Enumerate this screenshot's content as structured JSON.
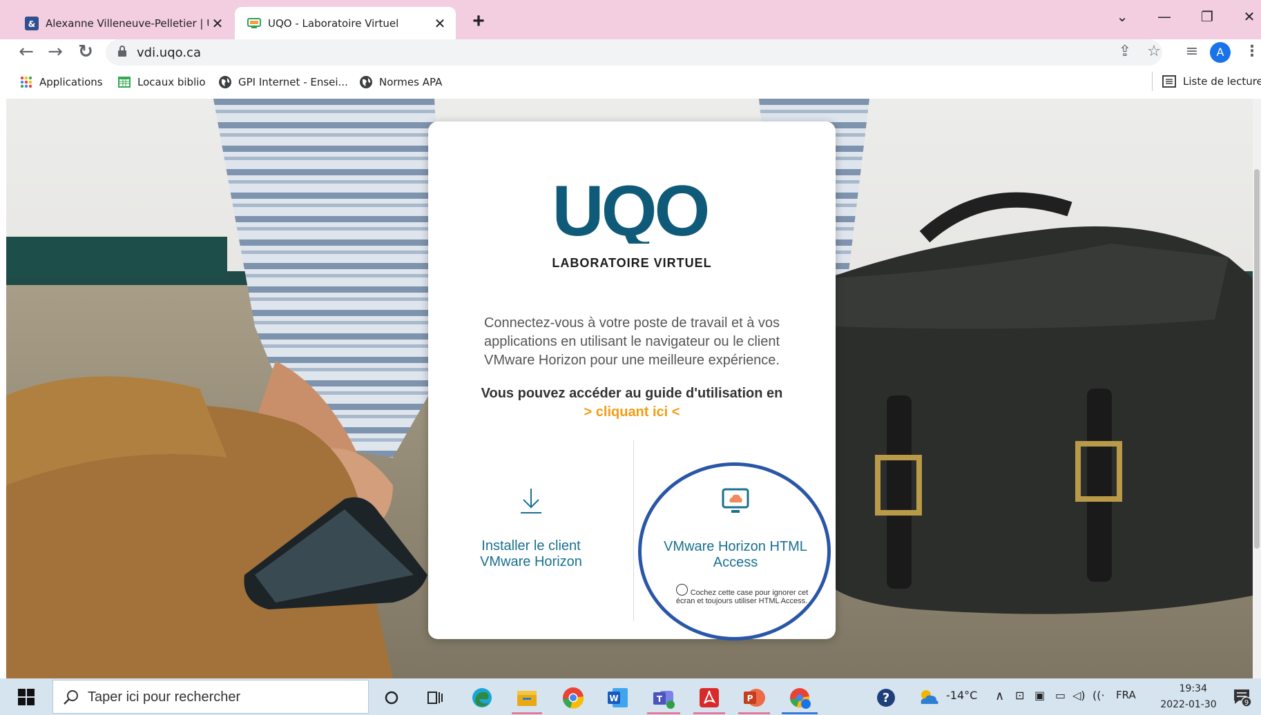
{
  "browser": {
    "tabs": [
      {
        "title": "Alexanne Villeneuve-Pelletier | UQ"
      },
      {
        "title": "UQO - Laboratoire Virtuel"
      }
    ],
    "new_tab": "+",
    "url": "vdi.uqo.ca",
    "profile_initial": "A",
    "bookmarks": [
      {
        "label": "Applications"
      },
      {
        "label": "Locaux biblio"
      },
      {
        "label": "GPI Internet - Ensei..."
      },
      {
        "label": "Normes APA"
      }
    ],
    "reading_list": "Liste de lecture"
  },
  "page": {
    "logo_text": "UQO",
    "subtitle": "LABORATOIRE VIRTUEL",
    "intro": "Connectez-vous à votre poste de travail et à vos applications en utilisant le navigateur ou le client VMware Horizon pour une meilleure expérience.",
    "guide_text": "Vous pouvez accéder au guide d'utilisation en",
    "guide_link": "> cliquant ici <",
    "install_option": "Installer le client VMware Horizon",
    "html_option": "VMware Horizon HTML Access",
    "skip_checkbox_label": "Cochez cette case pour ignorer cet écran et toujours utiliser HTML Access."
  },
  "taskbar": {
    "search_placeholder": "Taper ici pour rechercher",
    "weather": "-14°C",
    "language": "FRA",
    "time": "19:34",
    "date": "2022-01-30",
    "notifications": "9"
  },
  "colors": {
    "tab_strip": "#f3cde0",
    "uqo_teal": "#0f5a78",
    "link_teal": "#17708f",
    "guide_link": "#f39c12",
    "highlight_circle": "#2a56a8",
    "taskbar": "#d6e4ef"
  },
  "icons": [
    "start-icon",
    "search-icon",
    "cortana-icon",
    "task-view-icon",
    "edge-icon",
    "file-explorer-icon",
    "chrome-icon",
    "word-icon",
    "teams-icon",
    "acrobat-icon",
    "powerpoint-icon",
    "chrome-profile-icon",
    "help-icon",
    "weather-icon",
    "download-icon",
    "monitor-cloud-icon"
  ]
}
